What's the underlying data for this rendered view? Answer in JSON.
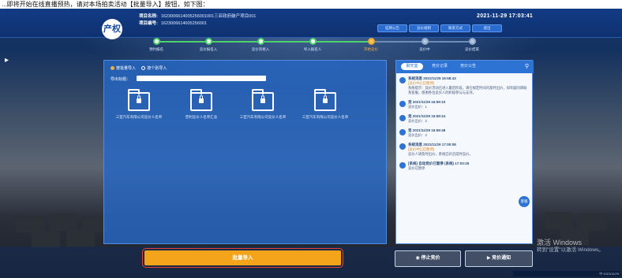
{
  "caption": "...即将开始在线直播预热，请对本场拍卖活动【批量导入】按钮，如下图：",
  "header": {
    "logo_text": "产权",
    "row1_label": "项目名称:",
    "row1_value": "1623006614005256001001三亚政府破产项目001",
    "row2_label": "项目编号:",
    "row2_value": "1623006614005256001",
    "datetime": "2021-11-29  17:03:41",
    "buttons": [
      "挂牌公告",
      "竞价规则",
      "联系方式",
      "退出"
    ]
  },
  "stepper": {
    "steps": [
      {
        "label": "预约报名",
        "state": "done"
      },
      {
        "label": "竞价报名入",
        "state": "done"
      },
      {
        "label": "竞价资格入",
        "state": "done"
      },
      {
        "label": "导入报名人",
        "state": "done"
      },
      {
        "label": "开始竞价",
        "state": "current"
      },
      {
        "label": "竞价中",
        "state": "todo"
      },
      {
        "label": "竞价结束",
        "state": "todo"
      }
    ]
  },
  "panel": {
    "radio_options": [
      "按批量导入",
      "按个别导入"
    ],
    "search_label": "导出标题：",
    "search_value": "",
    "folders": [
      {
        "name": "三亚汽车有限公司竞价人名单"
      },
      {
        "name": "普利竞价人名单汇总"
      },
      {
        "name": "三亚汽车有限公司竞价人名单"
      },
      {
        "name": "三亚汽车有限公司竞价人名单"
      }
    ]
  },
  "right_panel": {
    "tabs": [
      "聊天室",
      "竞价记录",
      "竞价公告"
    ],
    "messages": [
      {
        "title": "系统消息 2021/11/29 16:58:43",
        "status": "[竞价中] [已暂停]",
        "body": "系统提示：竞价活动已进入最后阶段，请在规定时间内及时出价，如有疑问请联系客服，感谢各位竞买人的积极参与与支持。"
      },
      {
        "title": "竞 2021/11/29 16:59:10",
        "status": "",
        "body": "竞价出价：1"
      },
      {
        "title": "竞 2021/11/29 16:59:24",
        "status": "",
        "body": "竞价出价：2"
      },
      {
        "title": "竞 2021/11/29 16:59:48",
        "status": "",
        "body": "竞价出价：3"
      },
      {
        "title": "系统消息 2021/11/29 17:00:08",
        "status": "[竞价中] [已暂停]",
        "body": "竞价人请及时出价，系统已开启延时竞价。"
      },
      {
        "title": "[系统] 自动竞价已暂停 (系统) 17:03:25",
        "status": "",
        "body": "竞价已暂停"
      }
    ],
    "chat_bubble": "客服"
  },
  "bottom": {
    "primary_label": "批量导入",
    "stop_label": "停止竞价",
    "notice_label": "竞价通知",
    "watermark_line1": "激活 Windows",
    "watermark_line2": "转到\"设置\"以激活 Windows。",
    "taskbar_text": "中 2021/11/29"
  }
}
